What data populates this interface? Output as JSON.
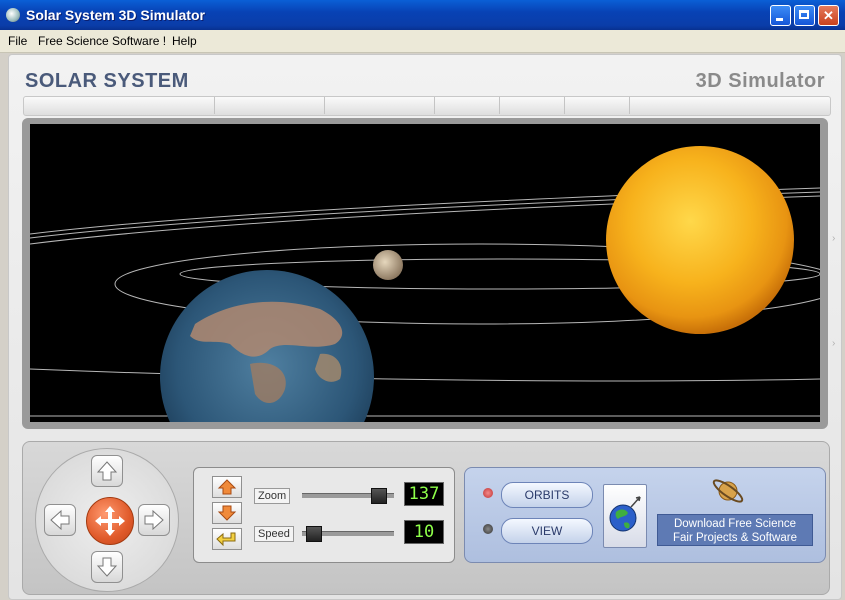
{
  "window": {
    "title": "Solar System 3D Simulator"
  },
  "menu": [
    "File",
    "Free Science Software !",
    "Help"
  ],
  "brand": {
    "left": "SOLAR SYSTEM",
    "right": "3D Simulator"
  },
  "controls": {
    "zoom": {
      "label": "Zoom",
      "value": "137",
      "slider_fraction": 0.88
    },
    "speed": {
      "label": "Speed",
      "value": "10",
      "slider_fraction": 0.05
    },
    "orbits_button": "ORBITS",
    "view_button": "VIEW",
    "download": {
      "line1": "Download Free Science",
      "line2": "Fair Projects & Software"
    }
  },
  "icons": {
    "dpad": [
      "arrow-up-icon",
      "arrow-left-icon",
      "move-icon",
      "arrow-right-icon",
      "arrow-down-icon"
    ],
    "zoom_controls": [
      "zoom-in-icon",
      "zoom-out-icon",
      "reset-icon"
    ],
    "globe": "globe-icon",
    "saturn": "saturn-icon"
  },
  "colors": {
    "title_bar": "#0842b5",
    "lcd_text": "#8eff4a",
    "accent_orange": "#e05a2a",
    "panel_blue": "#aebfdf"
  }
}
